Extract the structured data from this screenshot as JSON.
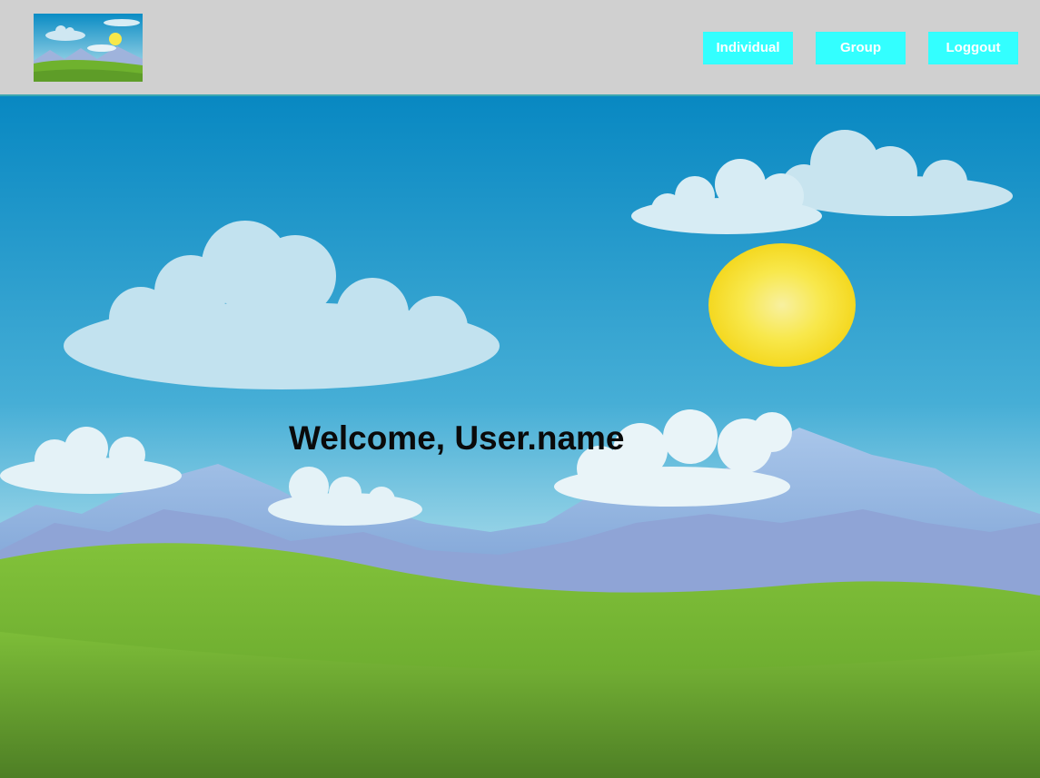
{
  "header": {
    "logo_icon": "landscape-logo-icon",
    "nav": {
      "individual_label": "Individual",
      "group_label": "Group",
      "logout_label": "Loggout"
    }
  },
  "main": {
    "welcome_text": "Welcome, User.name",
    "background_icon": "landscape-scene"
  },
  "colors": {
    "header_bg": "#d0d0d0",
    "button_bg": "#33ffff",
    "button_text": "#ffffff",
    "sky_top": "#0a8cc4",
    "sky_bottom": "#bfe6ef",
    "grass": "#6fb22e",
    "sun": "#f7e84a"
  }
}
